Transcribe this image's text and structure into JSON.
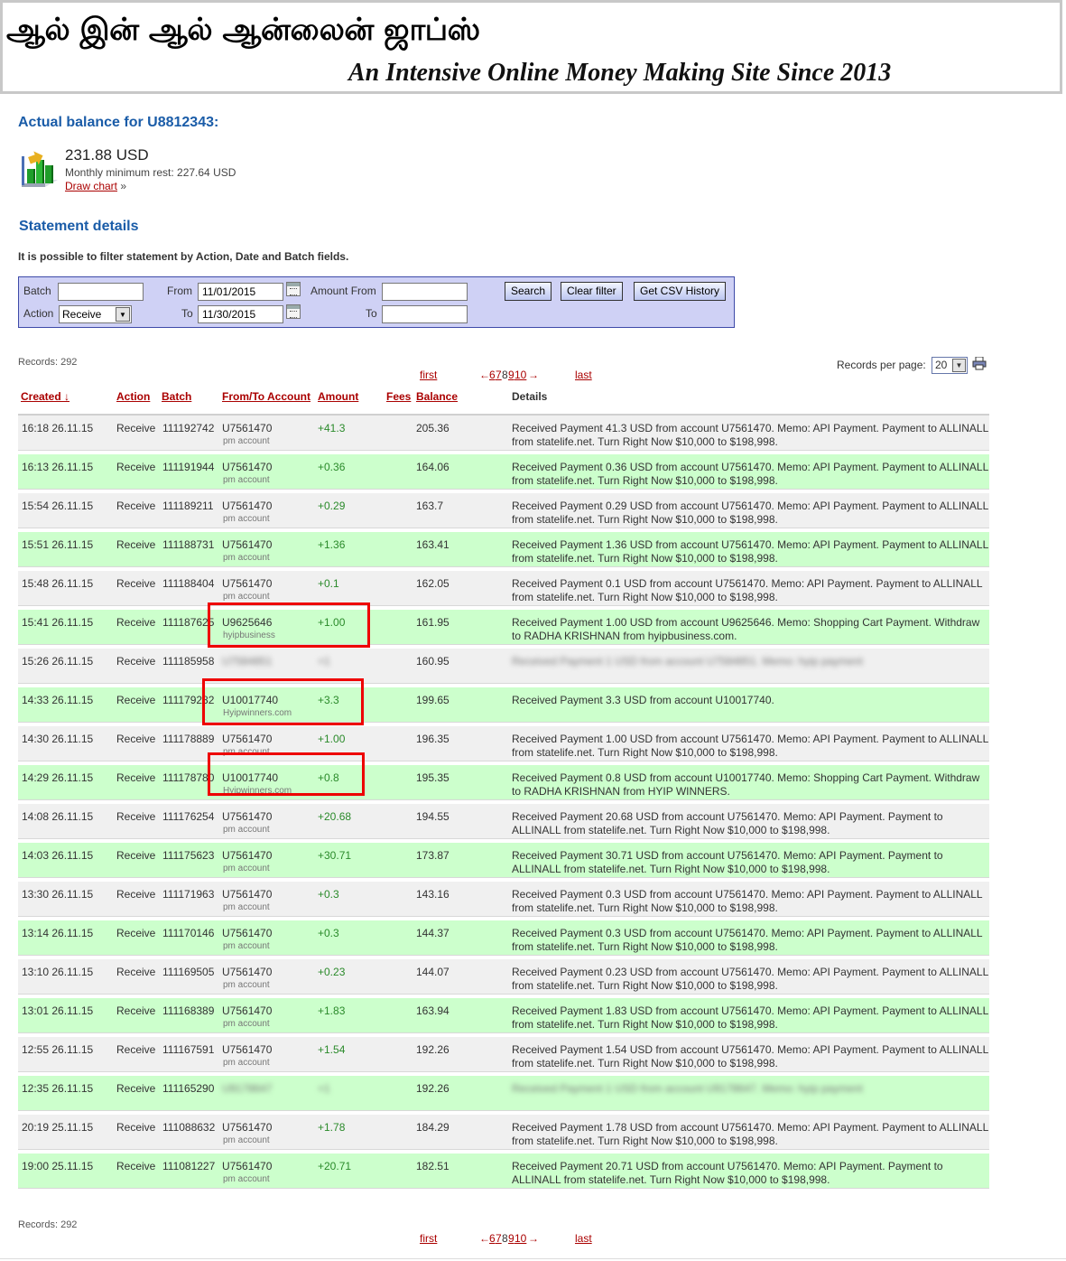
{
  "banner": {
    "title": "ஆல் இன் ஆல் ஆன்லைன் ஜாப்ஸ்",
    "tagline": "An Intensive Online Money Making Site Since 2013"
  },
  "balance": {
    "heading": "Actual balance for U8812343:",
    "amount": "231.88 USD",
    "monthly_min": "Monthly minimum rest: 227.64 USD",
    "chart_link": "Draw chart",
    "chart_link_suffix": " »",
    "icon": "bar-chart-icon"
  },
  "statement": {
    "heading": "Statement details",
    "info": "It is possible to filter statement by Action, Date and Batch fields."
  },
  "filter": {
    "batch_label": "Batch",
    "batch_value": "",
    "action_label": "Action",
    "action_value": "Receive",
    "from_label": "From",
    "from_value": "11/01/2015",
    "to_label": "To",
    "to_value": "11/30/2015",
    "amount_from_label": "Amount From",
    "amount_from_value": "",
    "amount_to_label": "To",
    "amount_to_value": "",
    "search_btn": "Search",
    "clear_btn": "Clear filter",
    "csv_btn": "Get CSV History"
  },
  "records": {
    "label": "Records: 292",
    "per_page_label": "Records per page:",
    "per_page_value": "20"
  },
  "pager": {
    "first": "first",
    "prev": "←",
    "pages": [
      "6",
      "7",
      "8",
      "9",
      "10"
    ],
    "next": "→",
    "last": "last"
  },
  "table": {
    "headers": {
      "created": "Created ↓",
      "action": "Action",
      "batch": "Batch",
      "account": "From/To Account",
      "amount": "Amount",
      "fees": "Fees",
      "balance": "Balance",
      "details": "Details"
    },
    "rows": [
      {
        "created": "16:18 26.11.15",
        "action": "Receive",
        "batch": "111192742",
        "account": "U7561470",
        "sub": "pm account",
        "amount": "+41.3",
        "balance": "205.36",
        "details": "Received Payment 41.3 USD from account U7561470. Memo: API Payment. Payment to ALLINALL from statelife.net. Turn Right Now $10,000 to $198,998."
      },
      {
        "created": "16:13 26.11.15",
        "action": "Receive",
        "batch": "111191944",
        "account": "U7561470",
        "sub": "pm account",
        "amount": "+0.36",
        "balance": "164.06",
        "details": "Received Payment 0.36 USD from account U7561470. Memo: API Payment. Payment to ALLINALL from statelife.net. Turn Right Now $10,000 to $198,998."
      },
      {
        "created": "15:54 26.11.15",
        "action": "Receive",
        "batch": "111189211",
        "account": "U7561470",
        "sub": "pm account",
        "amount": "+0.29",
        "balance": "163.7",
        "details": "Received Payment 0.29 USD from account U7561470. Memo: API Payment. Payment to ALLINALL from statelife.net. Turn Right Now $10,000 to $198,998."
      },
      {
        "created": "15:51 26.11.15",
        "action": "Receive",
        "batch": "111188731",
        "account": "U7561470",
        "sub": "pm account",
        "amount": "+1.36",
        "balance": "163.41",
        "details": "Received Payment 1.36 USD from account U7561470. Memo: API Payment. Payment to ALLINALL from statelife.net. Turn Right Now $10,000 to $198,998."
      },
      {
        "created": "15:48 26.11.15",
        "action": "Receive",
        "batch": "111188404",
        "account": "U7561470",
        "sub": "pm account",
        "amount": "+0.1",
        "balance": "162.05",
        "details": "Received Payment 0.1 USD from account U7561470. Memo: API Payment. Payment to ALLINALL from statelife.net. Turn Right Now $10,000 to $198,998."
      },
      {
        "created": "15:41 26.11.15",
        "action": "Receive",
        "batch": "111187625",
        "account": "U9625646",
        "sub": "hyipbusiness",
        "amount": "+1.00",
        "balance": "161.95",
        "details": "Received Payment 1.00 USD from account U9625646. Memo: Shopping Cart Payment. Withdraw to RADHA KRISHNAN from hyipbusiness.com."
      },
      {
        "created": "15:26 26.11.15",
        "action": "Receive",
        "batch": "111185958",
        "account": "U7584851",
        "sub": "",
        "amount": "+1",
        "balance": "160.95",
        "details": "Received Payment 1 USD from account U7584851. Memo: hyip payment",
        "blurred": true
      },
      {
        "created": "14:33 26.11.15",
        "action": "Receive",
        "batch": "111179282",
        "account": "U10017740",
        "sub": "Hyipwinners.com",
        "amount": "+3.3",
        "balance": "199.65",
        "details": "Received Payment 3.3 USD from account U10017740."
      },
      {
        "created": "14:30 26.11.15",
        "action": "Receive",
        "batch": "111178889",
        "account": "U7561470",
        "sub": "pm account",
        "amount": "+1.00",
        "balance": "196.35",
        "details": "Received Payment 1.00 USD from account U7561470. Memo: API Payment. Payment to ALLINALL from statelife.net. Turn Right Now $10,000 to $198,998."
      },
      {
        "created": "14:29 26.11.15",
        "action": "Receive",
        "batch": "111178780",
        "account": "U10017740",
        "sub": "Hyipwinners.com",
        "amount": "+0.8",
        "balance": "195.35",
        "details": "Received Payment 0.8 USD from account U10017740. Memo: Shopping Cart Payment. Withdraw to RADHA KRISHNAN from HYIP WINNERS."
      },
      {
        "created": "14:08 26.11.15",
        "action": "Receive",
        "batch": "111176254",
        "account": "U7561470",
        "sub": "pm account",
        "amount": "+20.68",
        "balance": "194.55",
        "details": "Received Payment 20.68 USD from account U7561470. Memo: API Payment. Payment to ALLINALL from statelife.net. Turn Right Now $10,000 to $198,998."
      },
      {
        "created": "14:03 26.11.15",
        "action": "Receive",
        "batch": "111175623",
        "account": "U7561470",
        "sub": "pm account",
        "amount": "+30.71",
        "balance": "173.87",
        "details": "Received Payment 30.71 USD from account U7561470. Memo: API Payment. Payment to ALLINALL from statelife.net. Turn Right Now $10,000 to $198,998."
      },
      {
        "created": "13:30 26.11.15",
        "action": "Receive",
        "batch": "111171963",
        "account": "U7561470",
        "sub": "pm account",
        "amount": "+0.3",
        "balance": "143.16",
        "details": "Received Payment 0.3 USD from account U7561470. Memo: API Payment. Payment to ALLINALL from statelife.net. Turn Right Now $10,000 to $198,998."
      },
      {
        "created": "13:14 26.11.15",
        "action": "Receive",
        "batch": "111170146",
        "account": "U7561470",
        "sub": "pm account",
        "amount": "+0.3",
        "balance": "144.37",
        "details": "Received Payment 0.3 USD from account U7561470. Memo: API Payment. Payment to ALLINALL from statelife.net. Turn Right Now $10,000 to $198,998."
      },
      {
        "created": "13:10 26.11.15",
        "action": "Receive",
        "batch": "111169505",
        "account": "U7561470",
        "sub": "pm account",
        "amount": "+0.23",
        "balance": "144.07",
        "details": "Received Payment 0.23 USD from account U7561470. Memo: API Payment. Payment to ALLINALL from statelife.net. Turn Right Now $10,000 to $198,998."
      },
      {
        "created": "13:01 26.11.15",
        "action": "Receive",
        "batch": "111168389",
        "account": "U7561470",
        "sub": "pm account",
        "amount": "+1.83",
        "balance": "163.94",
        "details": "Received Payment 1.83 USD from account U7561470. Memo: API Payment. Payment to ALLINALL from statelife.net. Turn Right Now $10,000 to $198,998."
      },
      {
        "created": "12:55 26.11.15",
        "action": "Receive",
        "batch": "111167591",
        "account": "U7561470",
        "sub": "pm account",
        "amount": "+1.54",
        "balance": "192.26",
        "details": "Received Payment 1.54 USD from account U7561470. Memo: API Payment. Payment to ALLINALL from statelife.net. Turn Right Now $10,000 to $198,998."
      },
      {
        "created": "12:35 26.11.15",
        "action": "Receive",
        "batch": "111165290",
        "account": "U9178647",
        "sub": "",
        "amount": "+1",
        "balance": "192.26",
        "details": "Received Payment 1 USD from account U9178647. Memo: hyip payment",
        "blurred": true
      },
      {
        "created": "20:19 25.11.15",
        "action": "Receive",
        "batch": "111088632",
        "account": "U7561470",
        "sub": "pm account",
        "amount": "+1.78",
        "balance": "184.29",
        "details": "Received Payment 1.78 USD from account U7561470. Memo: API Payment. Payment to ALLINALL from statelife.net. Turn Right Now $10,000 to $198,998."
      },
      {
        "created": "19:00 25.11.15",
        "action": "Receive",
        "batch": "111081227",
        "account": "U7561470",
        "sub": "pm account",
        "amount": "+20.71",
        "balance": "182.51",
        "details": "Received Payment 20.71 USD from account U7561470. Memo: API Payment. Payment to ALLINALL from statelife.net. Turn Right Now $10,000 to $198,998."
      }
    ]
  }
}
